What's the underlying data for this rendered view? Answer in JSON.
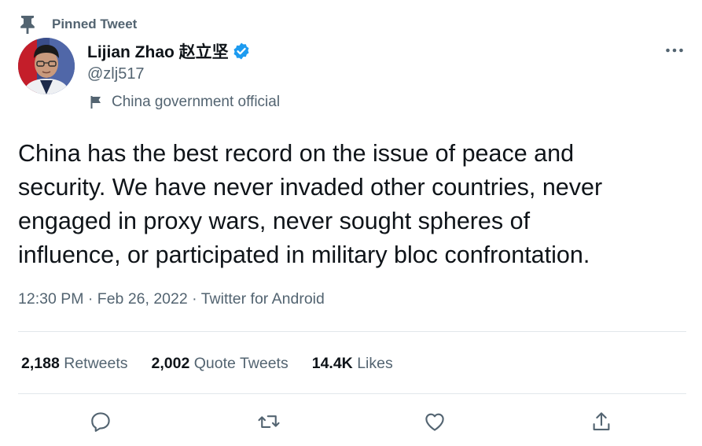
{
  "pinned": {
    "label": "Pinned Tweet"
  },
  "author": {
    "name": "Lijian Zhao 赵立坚",
    "handle": "@zlj517",
    "label": "China government official"
  },
  "tweet": {
    "text_lines": [
      "China has the best record on the issue of peace and",
      "security. We have never invaded other countries, never",
      "engaged in proxy wars, never sought spheres of",
      "influence, or participated in military bloc confrontation."
    ],
    "meta": "12:30 PM · Feb 26, 2022 · Twitter for Android"
  },
  "stats": [
    {
      "count": "2,188",
      "label": "Retweets"
    },
    {
      "count": "2,002",
      "label": "Quote Tweets"
    },
    {
      "count": "14.4K",
      "label": "Likes"
    }
  ],
  "actions": [
    "reply-icon",
    "retweet-icon",
    "like-icon",
    "share-icon"
  ],
  "colors": {
    "text_primary": "#0f1419",
    "text_secondary": "#536471",
    "verified_blue": "#1d9bf0",
    "divider": "#e2e7eb"
  }
}
